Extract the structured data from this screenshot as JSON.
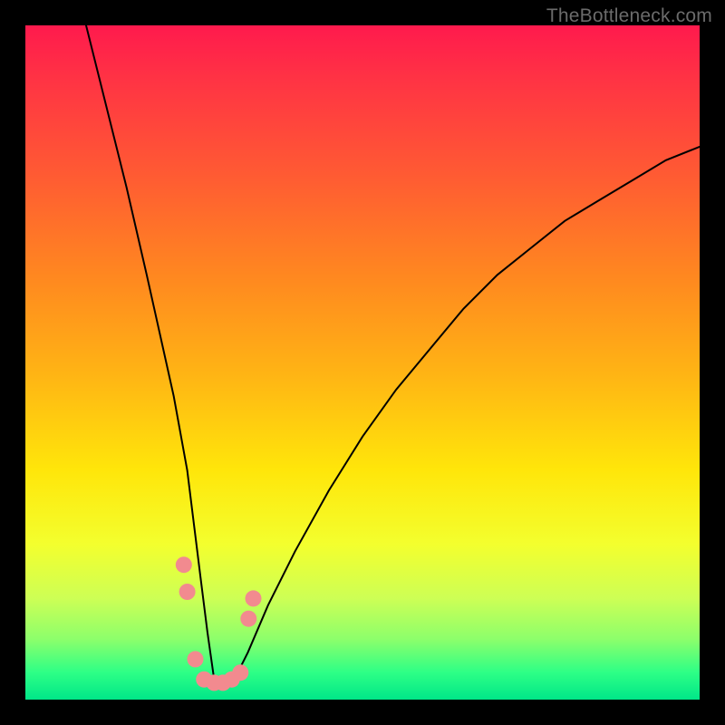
{
  "watermark": "TheBottleneck.com",
  "colors": {
    "background": "#000000",
    "gradient_top": "#ff1a4d",
    "gradient_bottom": "#00e688",
    "curve": "#000000",
    "dots": "#f28a8f"
  },
  "chart_data": {
    "type": "line",
    "title": "",
    "xlabel": "",
    "ylabel": "",
    "xlim": [
      0,
      100
    ],
    "ylim": [
      0,
      100
    ],
    "note": "No axis ticks or numeric labels are visible; values are relative 0–100 estimates from pixel positions. Curve is V-shaped with minimum near x≈28; markers cluster near the trough.",
    "series": [
      {
        "name": "curve",
        "x": [
          9,
          12,
          15,
          18,
          20,
          22,
          24,
          25,
          26,
          27,
          28,
          29,
          30,
          31,
          33,
          36,
          40,
          45,
          50,
          55,
          60,
          65,
          70,
          75,
          80,
          85,
          90,
          95,
          100
        ],
        "y": [
          100,
          88,
          76,
          63,
          54,
          45,
          34,
          26,
          18,
          10,
          3,
          2,
          2,
          3,
          7,
          14,
          22,
          31,
          39,
          46,
          52,
          58,
          63,
          67,
          71,
          74,
          77,
          80,
          82
        ]
      }
    ],
    "markers": [
      {
        "x": 23.5,
        "y": 20
      },
      {
        "x": 24.0,
        "y": 16
      },
      {
        "x": 25.2,
        "y": 6
      },
      {
        "x": 26.5,
        "y": 3
      },
      {
        "x": 28.0,
        "y": 2.5
      },
      {
        "x": 29.3,
        "y": 2.5
      },
      {
        "x": 30.6,
        "y": 3
      },
      {
        "x": 31.9,
        "y": 4
      },
      {
        "x": 33.1,
        "y": 12
      },
      {
        "x": 33.8,
        "y": 15
      }
    ]
  }
}
